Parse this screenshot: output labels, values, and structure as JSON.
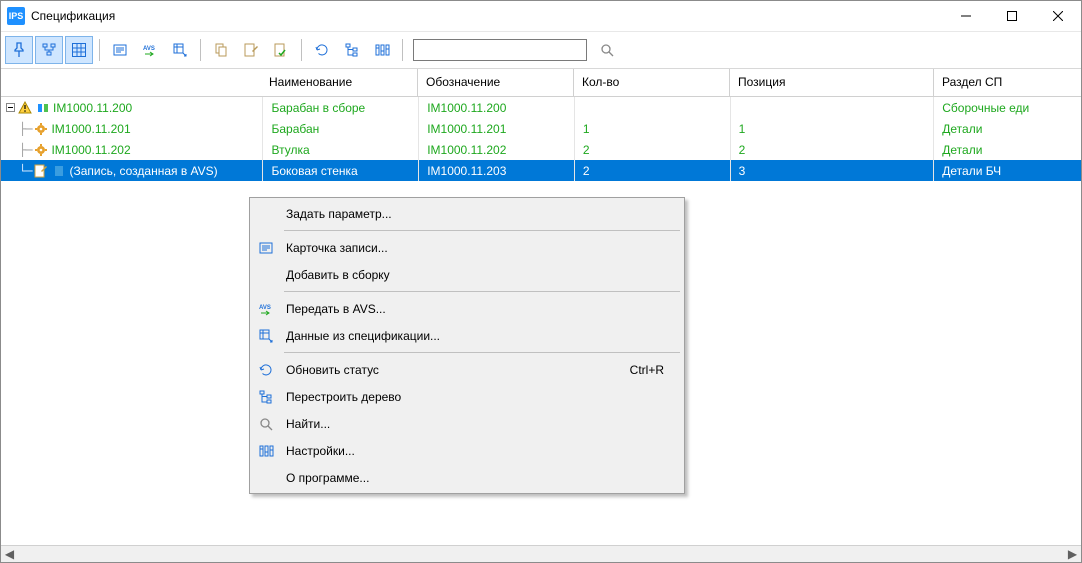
{
  "window": {
    "title": "Спецификация",
    "app_icon_text": "IPS"
  },
  "columns": {
    "name": "Наименование",
    "designation": "Обозначение",
    "qty": "Кол-во",
    "position": "Позиция",
    "section": "Раздел СП"
  },
  "rows": [
    {
      "tree": "IM1000.11.200",
      "name": "Барабан в сборе",
      "designation": "IM1000.11.200",
      "qty": "",
      "position": "",
      "section": "Сборочные еди",
      "level": 0,
      "expanded": true,
      "selected": false,
      "icons": "root"
    },
    {
      "tree": "IM1000.11.201",
      "name": "Барабан",
      "designation": "IM1000.11.201",
      "qty": "1",
      "position": "1",
      "section": "Детали",
      "level": 1,
      "selected": false,
      "icons": "gear"
    },
    {
      "tree": "IM1000.11.202",
      "name": "Втулка",
      "designation": "IM1000.11.202",
      "qty": "2",
      "position": "2",
      "section": "Детали",
      "level": 1,
      "selected": false,
      "icons": "gear"
    },
    {
      "tree": "(Запись, созданная в AVS)",
      "name": "Боковая стенка",
      "designation": "IM1000.11.203",
      "qty": "2",
      "position": "3",
      "section": "Детали БЧ",
      "level": 1,
      "selected": true,
      "icons": "avs"
    }
  ],
  "context_menu": {
    "items": [
      {
        "label": "Задать параметр...",
        "icon": ""
      },
      {
        "sep": true
      },
      {
        "label": "Карточка записи...",
        "icon": "card"
      },
      {
        "label": "Добавить в сборку",
        "icon": ""
      },
      {
        "sep": true
      },
      {
        "label": "Передать в AVS...",
        "icon": "avs"
      },
      {
        "label": "Данные из спецификации...",
        "icon": "spec"
      },
      {
        "sep": true
      },
      {
        "label": "Обновить статус",
        "icon": "refresh",
        "accel": "Ctrl+R"
      },
      {
        "label": "Перестроить дерево",
        "icon": "tree"
      },
      {
        "label": "Найти...",
        "icon": "search"
      },
      {
        "label": "Настройки...",
        "icon": "settings"
      },
      {
        "label": "О программе...",
        "icon": ""
      }
    ]
  },
  "search": {
    "placeholder": ""
  }
}
